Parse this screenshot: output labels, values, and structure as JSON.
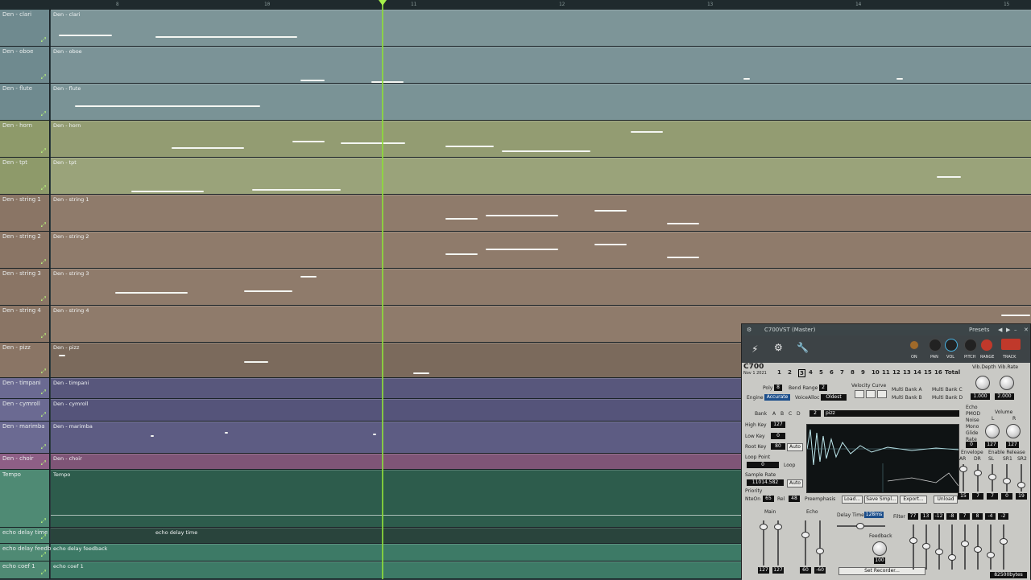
{
  "ruler": {
    "ticks": [
      "8",
      "10",
      "11",
      "12",
      "13",
      "14",
      "15"
    ]
  },
  "tracks": [
    {
      "name": "Den - clari",
      "clip": "Den - clari"
    },
    {
      "name": "Den - oboe",
      "clip": "Den - oboe"
    },
    {
      "name": "Den - flute",
      "clip": "Den - flute"
    },
    {
      "name": "Den - horn",
      "clip": "Den - horn"
    },
    {
      "name": "Den - tpt",
      "clip": "Den - tpt"
    },
    {
      "name": "Den - string 1",
      "clip": "Den - string 1"
    },
    {
      "name": "Den - string 2",
      "clip": "Den - string 2"
    },
    {
      "name": "Den - string 3",
      "clip": "Den - string 3"
    },
    {
      "name": "Den - string 4",
      "clip": "Den - string 4"
    },
    {
      "name": "Den - pizz",
      "clip": "Den - pizz"
    },
    {
      "name": "Den - timpani",
      "clip": "Den - timpani"
    },
    {
      "name": "Den - cymroll",
      "clip": "Den - cymroll"
    },
    {
      "name": "Den - marimba",
      "clip": "Den - marimba"
    },
    {
      "name": "Den - choir",
      "clip": "Den - choir"
    },
    {
      "name": "Tempo",
      "clip": "Tempo"
    },
    {
      "name": "echo delay time",
      "clip": "echo delay time"
    },
    {
      "name": "echo delay feedba",
      "clip": "echo delay feedback"
    },
    {
      "name": "echo coef 1",
      "clip": "echo coef 1"
    }
  ],
  "plugin": {
    "title": "C700VST (Master)",
    "presets": "Presets",
    "on": "ON",
    "pan": "PAN",
    "vol": "VOL",
    "pitch": "PITCH",
    "range": "RANGE",
    "track": "TRACK",
    "logo": "C700",
    "date": "Nov 1 2021",
    "channels": [
      "1",
      "2",
      "3",
      "4",
      "5",
      "6",
      "7",
      "8",
      "9",
      "10",
      "11",
      "12",
      "13",
      "14",
      "15",
      "16",
      "Total"
    ],
    "vib_depth": "Vib.Depth",
    "vib_rate": "Vib.Rate",
    "vib_depth_val": "1.000",
    "vib_rate_val": "2.000",
    "poly": "Poly",
    "poly_val": "8",
    "bend_range": "Bend Range",
    "bend_val": "2",
    "velocity_curve": "Velocity Curve",
    "engine": "Engine",
    "engine_val": "Accurate",
    "voice_alloc": "VoiceAlloc",
    "voice_alloc_val": "Oldest",
    "multi_bank": [
      "Multi Bank A",
      "Multi Bank B",
      "Multi Bank C",
      "Multi Bank D"
    ],
    "bank": "Bank",
    "banks": [
      "A",
      "B",
      "C",
      "D"
    ],
    "prog_num": "2",
    "prog_name": "pizz",
    "high_key": "High Key",
    "high_key_val": "127",
    "low_key": "Low Key",
    "low_key_val": "0",
    "root_key": "Root Key",
    "root_key_val": "80",
    "auto": "Auto",
    "loop_point": "Loop Point",
    "loop_val": "0",
    "loop": "Loop",
    "sample_rate": "Sample Rate",
    "sample_rate_val": "11014.582",
    "priority": "Priority",
    "note_on": "NteOn",
    "note_on_val": "65",
    "rel": "Rel",
    "rel_val": "48",
    "preemphasis": "Preemphasis",
    "load": "Load...",
    "save_smpl": "Save Smpl...",
    "export": "Export...",
    "unload": "Unload",
    "echo": "Echo",
    "pmod": "PMOD",
    "noise": "Noise",
    "mono": "Mono",
    "glide": "Glide",
    "rate": "Rate",
    "volume": "Volume",
    "l": "L",
    "r": "R",
    "vol_l": "127",
    "vol_r": "127",
    "glide_val": "0",
    "envelope": "Envelope",
    "enable_release": "Enable Release",
    "env_labels": [
      "AR",
      "DR",
      "SL",
      "SR1",
      "SR2"
    ],
    "env_vals": [
      "15",
      "7",
      "7",
      "0",
      "19"
    ],
    "main": "Main",
    "main_l": "127",
    "main_r": "127",
    "echo_lbl": "Echo",
    "echo_l": "60",
    "echo_r": "-60",
    "delay_time": "Delay Time",
    "delay_val": "128ms",
    "feedback": "Feedback",
    "feedback_val": "100",
    "filter": "Filter",
    "filter_vals": [
      "77",
      "13",
      "-12",
      "-8",
      "7",
      "8",
      "-4",
      "-2"
    ],
    "set_recorder": "Set Recorder...",
    "bytes": "82500bytes"
  },
  "colors": {
    "accent": "#8ddc3a",
    "red": "#c0392b"
  }
}
